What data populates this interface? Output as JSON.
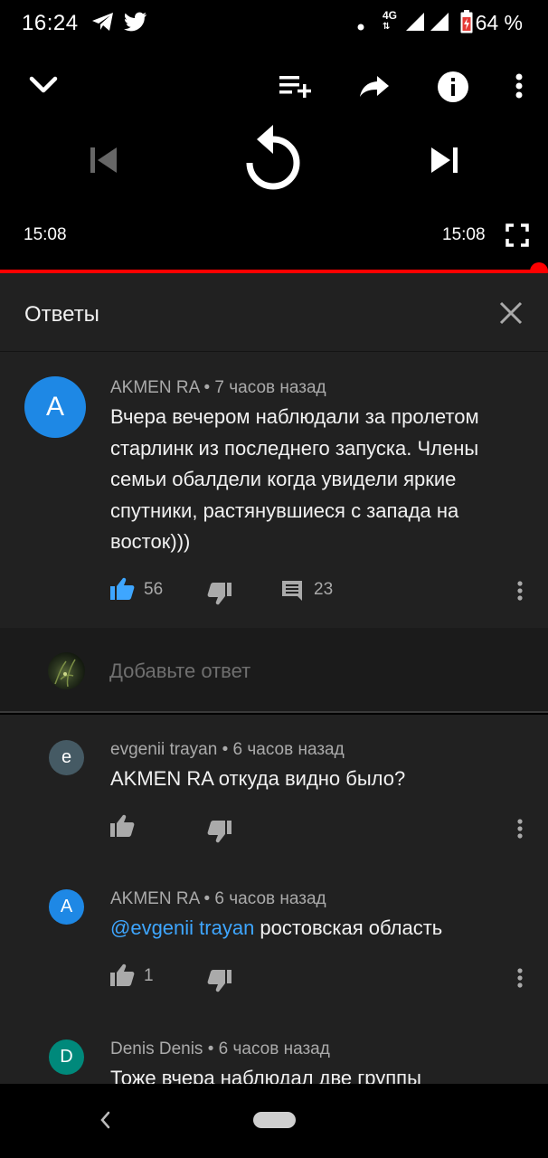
{
  "status_bar": {
    "time": "16:24",
    "network": "4G",
    "battery": "64 %",
    "icons": [
      "telegram-icon",
      "twitter-icon",
      "dot-icon",
      "signal-icon",
      "signal-icon",
      "battery-icon"
    ]
  },
  "player": {
    "current_time": "15:08",
    "duration": "15:08",
    "progress": 1.0,
    "accent_color": "#ff0000",
    "icons": [
      "chevron-down-icon",
      "add-to-playlist-icon",
      "share-icon",
      "info-icon",
      "more-vert-icon",
      "previous-icon",
      "replay-icon",
      "next-icon",
      "fullscreen-icon"
    ]
  },
  "replies_panel": {
    "title": "Ответы"
  },
  "main_comment": {
    "avatar_letter": "A",
    "avatar_color": "#1e88e5",
    "author": "AKMEN RA",
    "time": "7 часов назад",
    "text_lines": [
      "Вчера вечером наблюдали за пролетом",
      "старлинк из последнего запуска. Члены",
      "семьи обалдели когда увидели яркие",
      "спутники, растянувшиеся с запада на",
      "восток)))"
    ],
    "likes": "56",
    "replies": "23",
    "liked": true
  },
  "add_reply": {
    "placeholder": "Добавьте ответ"
  },
  "replies": [
    {
      "avatar_letter": "e",
      "avatar_color": "#455a64",
      "author": "evgenii trayan",
      "time": "6 часов назад",
      "mention": "",
      "text": "AKMEN RA откуда видно было?",
      "likes": ""
    },
    {
      "avatar_letter": "A",
      "avatar_color": "#1e88e5",
      "author": "AKMEN RA",
      "time": "6 часов назад",
      "mention": "@evgenii trayan",
      "text": " ростовская область",
      "likes": "1"
    },
    {
      "avatar_letter": "D",
      "avatar_color": "#00897b",
      "author": "Denis Denis",
      "time": "6 часов назад",
      "mention": "",
      "text": "Тоже вчера наблюдал две группы",
      "likes": ""
    }
  ],
  "meta_separator": "•"
}
